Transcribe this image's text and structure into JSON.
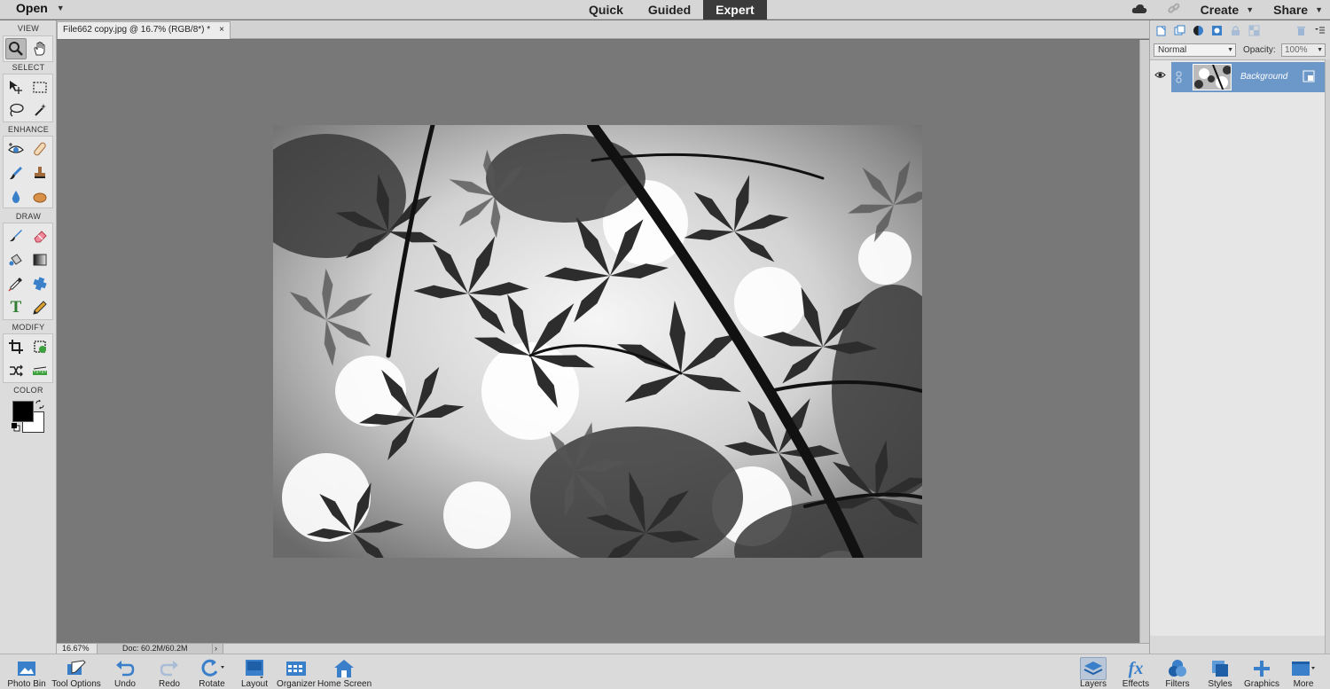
{
  "topbar": {
    "open_label": "Open",
    "modes": [
      "Quick",
      "Guided",
      "Expert"
    ],
    "active_mode": "Expert",
    "create_label": "Create",
    "share_label": "Share"
  },
  "document_tab": {
    "title": "File662 copy.jpg @ 16.7% (RGB/8*) *",
    "close": "×"
  },
  "toolbox": {
    "sections": {
      "view": "VIEW",
      "select": "SELECT",
      "enhance": "ENHANCE",
      "draw": "DRAW",
      "modify": "MODIFY",
      "color": "COLOR"
    },
    "text_tool_glyph": "T"
  },
  "statusbar": {
    "zoom": "16.67%",
    "doc_size": "Doc: 60.2M/60.2M",
    "arrow": "›"
  },
  "layers_panel": {
    "blend_mode": "Normal",
    "opacity_label": "Opacity:",
    "opacity_value": "100%",
    "layers": [
      {
        "name": "Background",
        "visible": true,
        "selected": true
      }
    ]
  },
  "bottombar": {
    "left": [
      "Photo Bin",
      "Tool Options",
      "Undo",
      "Redo",
      "Rotate",
      "Layout",
      "Organizer",
      "Home Screen"
    ],
    "right": [
      "Layers",
      "Effects",
      "Filters",
      "Styles",
      "Graphics",
      "More"
    ],
    "fx_glyph": "fx"
  },
  "colors": {
    "accent_blue": "#3a7fc9",
    "layer_selected": "#6c97c9",
    "active_mode_bg": "#3b3b3b"
  }
}
